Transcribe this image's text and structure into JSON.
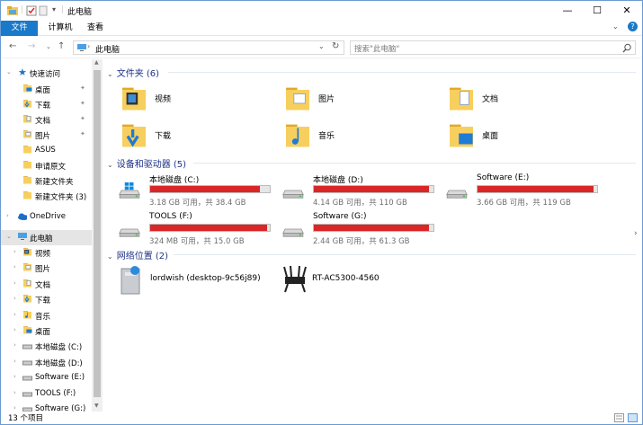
{
  "window": {
    "title": "此电脑",
    "minimize": "—",
    "maximize": "☐",
    "close": "✕",
    "help": "?"
  },
  "colors": {
    "accent": "#1979ca",
    "drive_bar": "#da2626",
    "group_heading": "#1e3287"
  },
  "ribbon": {
    "tabs": [
      "文件",
      "计算机",
      "查看"
    ]
  },
  "address": {
    "path": "此电脑",
    "search_placeholder": "搜索\"此电脑\""
  },
  "nav": {
    "quick_access": "快速访问",
    "quick_items": [
      {
        "label": "桌面",
        "icon": "desktop-folder-icon",
        "pinned": true
      },
      {
        "label": "下载",
        "icon": "download-folder-icon",
        "pinned": true
      },
      {
        "label": "文档",
        "icon": "documents-folder-icon",
        "pinned": true
      },
      {
        "label": "图片",
        "icon": "pictures-folder-icon",
        "pinned": true
      },
      {
        "label": "ASUS",
        "icon": "folder-icon",
        "pinned": false
      },
      {
        "label": "申请原文",
        "icon": "folder-icon",
        "pinned": false
      },
      {
        "label": "新建文件夹",
        "icon": "folder-icon",
        "pinned": false
      },
      {
        "label": "新建文件夹 (3)",
        "icon": "folder-icon",
        "pinned": false
      }
    ],
    "onedrive": "OneDrive",
    "this_pc": "此电脑",
    "pc_items": [
      {
        "label": "视频",
        "icon": "videos-folder-icon"
      },
      {
        "label": "图片",
        "icon": "pictures-folder-icon"
      },
      {
        "label": "文档",
        "icon": "documents-folder-icon"
      },
      {
        "label": "下载",
        "icon": "download-folder-icon"
      },
      {
        "label": "音乐",
        "icon": "music-folder-icon"
      },
      {
        "label": "桌面",
        "icon": "desktop-folder-icon"
      },
      {
        "label": "本地磁盘 (C:)",
        "icon": "drive-icon"
      },
      {
        "label": "本地磁盘 (D:)",
        "icon": "drive-icon"
      },
      {
        "label": "Software (E:)",
        "icon": "drive-icon"
      },
      {
        "label": "TOOLS (F:)",
        "icon": "drive-icon"
      },
      {
        "label": "Software (G:)",
        "icon": "drive-icon"
      }
    ]
  },
  "groups": {
    "folders": {
      "heading": "文件夹 (6)",
      "items": [
        {
          "label": "视频",
          "icon": "videos-folder-icon"
        },
        {
          "label": "图片",
          "icon": "pictures-folder-icon"
        },
        {
          "label": "文档",
          "icon": "documents-folder-icon"
        },
        {
          "label": "下载",
          "icon": "download-folder-icon"
        },
        {
          "label": "音乐",
          "icon": "music-folder-icon"
        },
        {
          "label": "桌面",
          "icon": "desktop-folder-icon"
        }
      ]
    },
    "drives": {
      "heading": "设备和驱动器 (5)",
      "items": [
        {
          "name": "本地磁盘 (C:)",
          "space": "3.18 GB 可用，共 38.4 GB",
          "used_fraction": 0.917,
          "icon": "windows-drive-icon"
        },
        {
          "name": "本地磁盘 (D:)",
          "space": "4.14 GB 可用，共 110 GB",
          "used_fraction": 0.962,
          "icon": "drive-icon"
        },
        {
          "name": "Software (E:)",
          "space": "3.66 GB 可用，共 119 GB",
          "used_fraction": 0.969,
          "icon": "drive-icon"
        },
        {
          "name": "TOOLS (F:)",
          "space": "324 MB 可用，共 15.0 GB",
          "used_fraction": 0.979,
          "icon": "drive-icon"
        },
        {
          "name": "Software (G:)",
          "space": "2.44 GB 可用，共 61.3 GB",
          "used_fraction": 0.96,
          "icon": "drive-icon"
        }
      ]
    },
    "network": {
      "heading": "网络位置 (2)",
      "items": [
        {
          "label": "lordwish (desktop-9c56j89)",
          "icon": "media-server-icon"
        },
        {
          "label": "RT-AC5300-4560",
          "icon": "router-icon"
        }
      ]
    }
  },
  "status": {
    "count": "13 个项目"
  }
}
